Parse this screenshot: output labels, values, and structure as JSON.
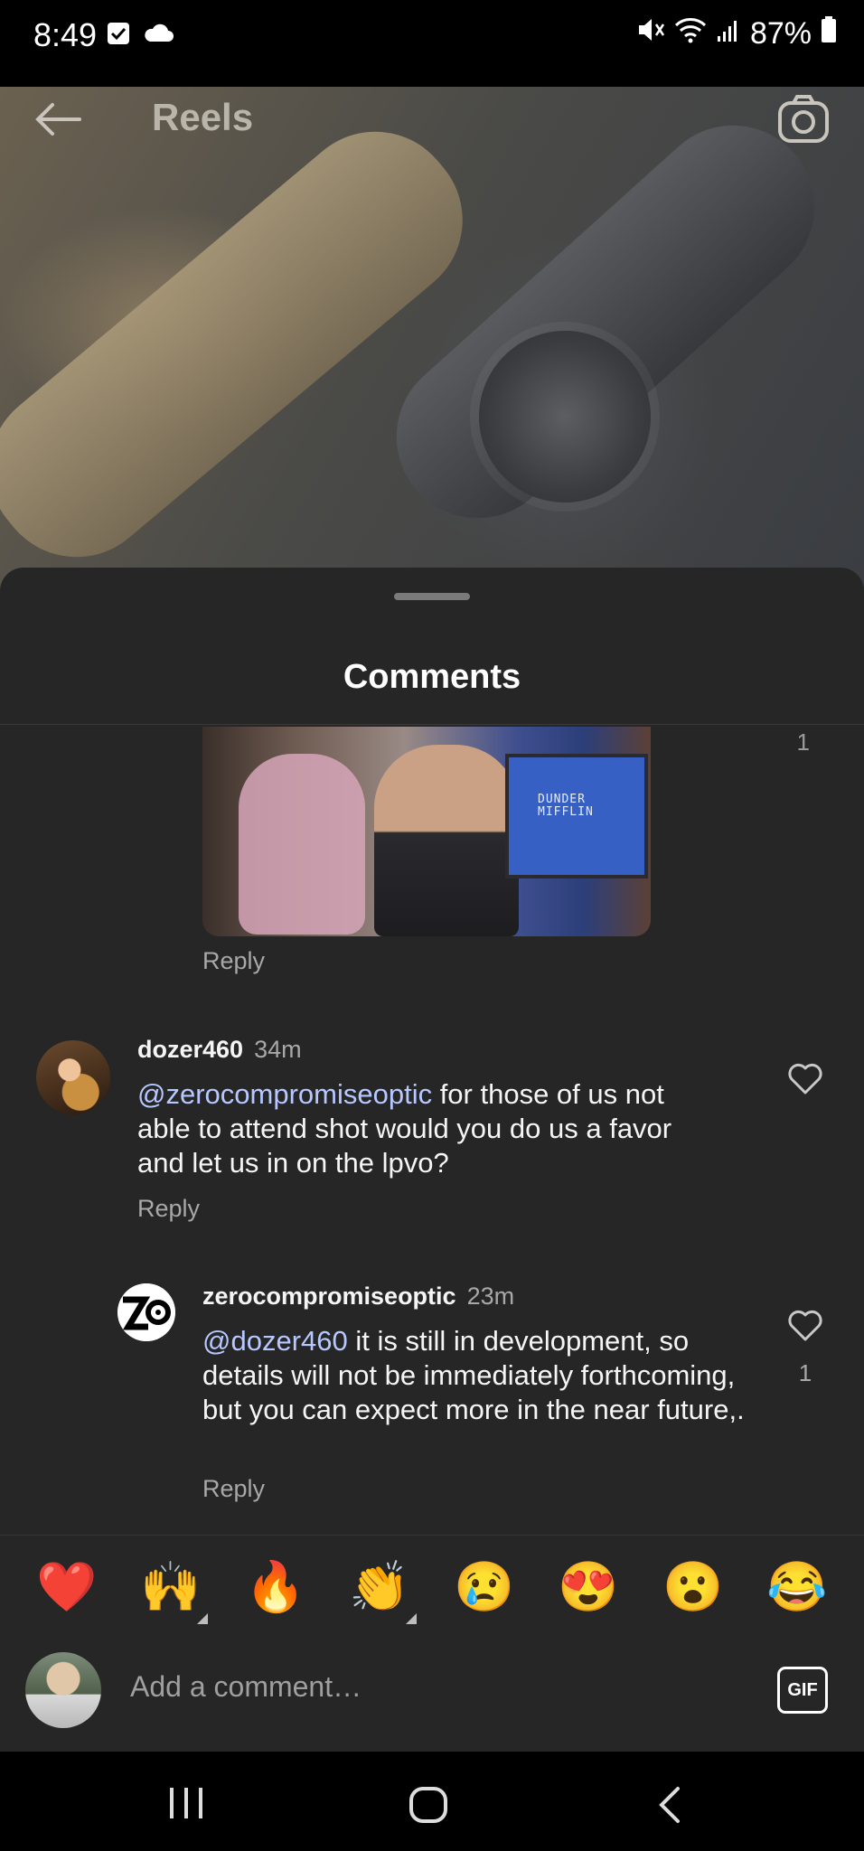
{
  "status_bar": {
    "time": "8:49",
    "battery": "87%",
    "left_icons": [
      "checkbox-icon",
      "cloud-icon"
    ],
    "right_icons": [
      "mute-icon",
      "wifi-icon",
      "signal-icon",
      "battery-icon"
    ]
  },
  "reel": {
    "title": "Reels"
  },
  "comments_sheet": {
    "title": "Comments",
    "partial_comment": {
      "like_count": "1",
      "gif_sign_text": "DUNDER\nMIFFLIN",
      "reply_label": "Reply"
    },
    "comments": [
      {
        "username": "dozer460",
        "time": "34m",
        "mention": "@zerocompromiseoptic",
        "text": " for those of us not able to attend shot would you do us a favor and let us in on the lpvo?",
        "reply_label": "Reply",
        "like_count": ""
      },
      {
        "username": "zerocompromiseoptic",
        "time": "23m",
        "mention": "@dozer460",
        "text": " it is still in development, so details will not be immediately forthcoming, but you can expect more in the near future,.",
        "reply_label": "Reply",
        "like_count": "1"
      }
    ]
  },
  "reactions": [
    "❤️",
    "🙌",
    "🔥",
    "👏",
    "😢",
    "😍",
    "😮",
    "😂"
  ],
  "composer": {
    "placeholder": "Add a comment…",
    "gif_label": "GIF"
  },
  "colors": {
    "sheet_bg": "#262626",
    "mention": "#b6c8ff",
    "secondary_text": "#a8a8a8"
  }
}
